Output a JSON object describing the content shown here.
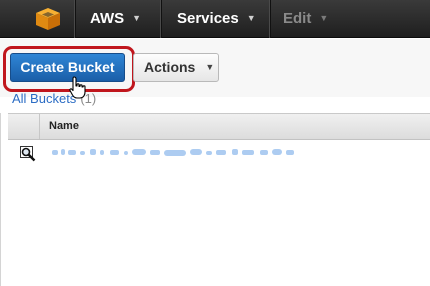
{
  "topbar": {
    "logo_icon": "aws-cube-icon",
    "aws_label": "AWS",
    "services_label": "Services",
    "edit_label": "Edit"
  },
  "toolbar": {
    "create_bucket_label": "Create Bucket",
    "actions_label": "Actions",
    "highlight_color": "#c0161d",
    "primary_color": "#1f6fc0"
  },
  "breadcrumb": {
    "title": "All Buckets",
    "count": "(1)"
  },
  "table": {
    "columns": [
      "Name"
    ],
    "rows": [
      {
        "icon": "bucket-magnifier-icon",
        "name": ""
      }
    ]
  },
  "cursor": {
    "icon": "hand-pointer-icon"
  }
}
